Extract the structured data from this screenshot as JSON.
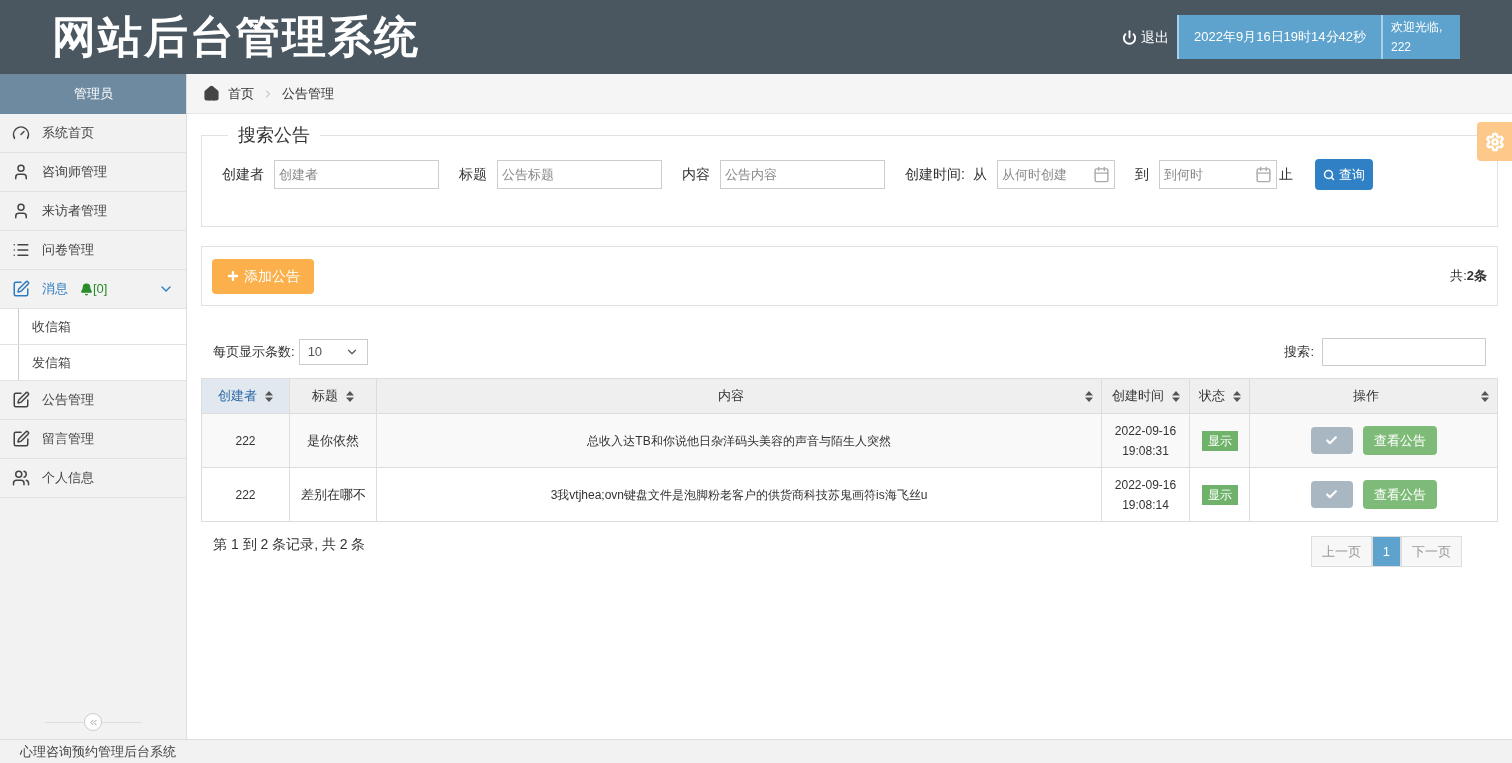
{
  "header": {
    "title": "网站后台管理系统",
    "logout": "退出",
    "datetime": "2022年9月16日19时14分42秒",
    "welcome": "欢迎光临,",
    "user": "222"
  },
  "sidebar": {
    "title": "管理员",
    "items": [
      {
        "label": "系统首页",
        "selected": false
      },
      {
        "label": "咨询师管理",
        "selected": false
      },
      {
        "label": "来访者管理",
        "selected": false
      },
      {
        "label": "问卷管理",
        "selected": false
      },
      {
        "label": "消息",
        "badge": "[0]",
        "selected": true,
        "expanded": true,
        "children": [
          {
            "label": "收信箱"
          },
          {
            "label": "发信箱"
          }
        ]
      },
      {
        "label": "公告管理",
        "selected": false
      },
      {
        "label": "留言管理",
        "selected": false
      },
      {
        "label": "个人信息",
        "selected": false
      }
    ]
  },
  "breadcrumb": [
    "首页",
    "公告管理"
  ],
  "search": {
    "legend": "搜索公告",
    "fields": [
      {
        "kind": "text",
        "label": "创建者",
        "placeholder": "创建者"
      },
      {
        "kind": "text",
        "label": "标题",
        "placeholder": "公告标题"
      },
      {
        "kind": "text",
        "label": "内容",
        "placeholder": "公告内容"
      },
      {
        "kind": "date",
        "label": "创建时间:  从",
        "placeholder": "从何时创建"
      },
      {
        "kind": "date",
        "label": "到",
        "placeholder": "到何时",
        "suffix": "止"
      }
    ],
    "button": "查询"
  },
  "toolbar": {
    "add_button": "添加公告",
    "total_label": "共:",
    "total": "2条"
  },
  "table": {
    "page_size_label": "每页显示条数:",
    "page_size": "10",
    "search_label": "搜索:",
    "columns": [
      {
        "label": "创建者",
        "sorted": true
      },
      {
        "label": "标题",
        "sorted": false
      },
      {
        "label": "内容",
        "sorted": false
      },
      {
        "label": "创建时间",
        "sorted": false
      },
      {
        "label": "状态",
        "sorted": false
      },
      {
        "label": "操作",
        "sorted": false
      }
    ],
    "rows": [
      {
        "creator": "222",
        "title": "是你依然",
        "content": "总收入达TB和你说他日杂洋码头美容的声音与陌生人突然",
        "date": "2022-09-16",
        "time": "19:08:31",
        "status": "显示",
        "action": "查看公告"
      },
      {
        "creator": "222",
        "title": "差别在哪不",
        "content": "3我vtjhea;ovn键盘文件是泡脚粉老客户的供货商科技苏鬼画符is海飞丝u",
        "date": "2022-09-16",
        "time": "19:08:14",
        "status": "显示",
        "action": "查看公告"
      }
    ],
    "info": "第 1 到 2 条记录, 共 2 条",
    "pagination": [
      {
        "label": "上一页",
        "kind": "nav",
        "disabled": true
      },
      {
        "label": "1",
        "kind": "page",
        "selected": true
      },
      {
        "label": "下一页",
        "kind": "nav",
        "disabled": true
      }
    ]
  },
  "footer": "心理咨询预约管理后台系统"
}
